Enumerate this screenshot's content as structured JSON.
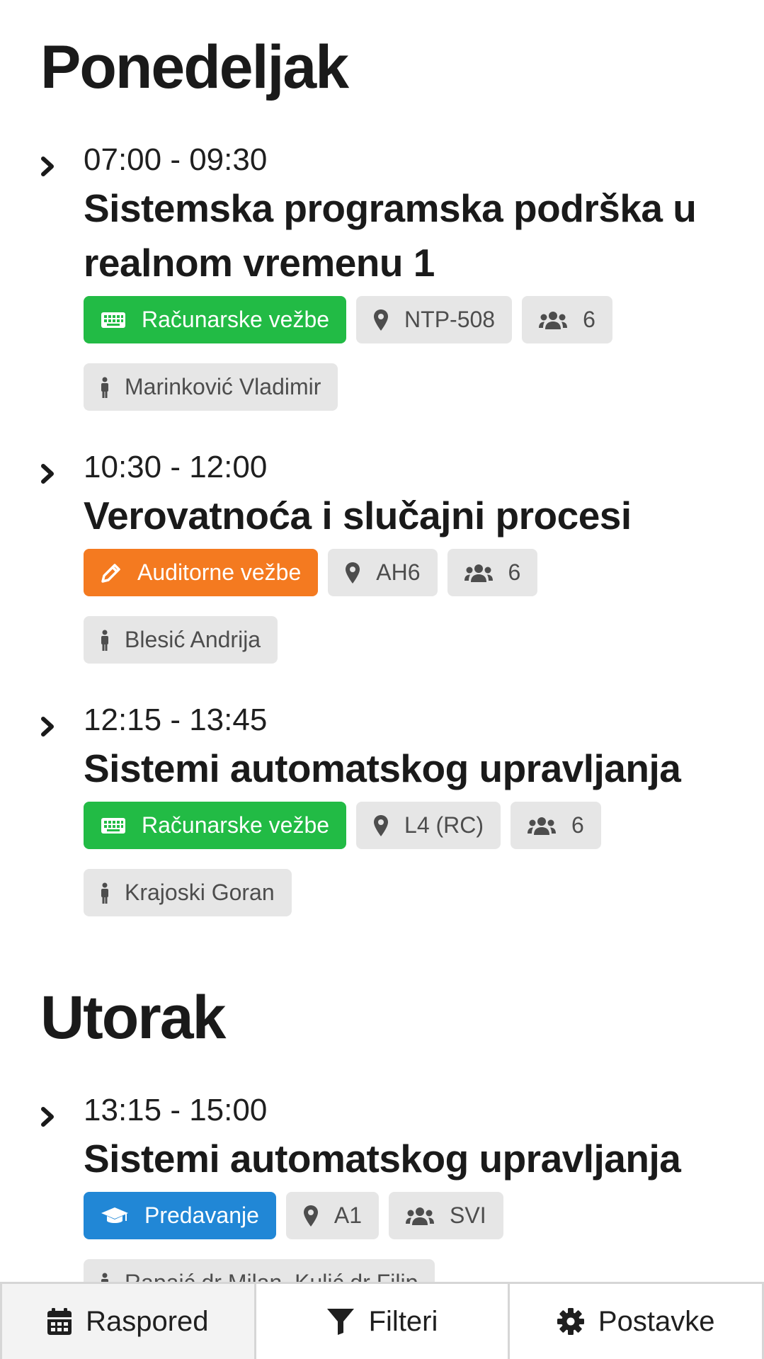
{
  "days": [
    {
      "title": "Ponedeljak",
      "lessons": [
        {
          "time": "07:00 - 09:30",
          "subject_line1": "Sistemska programska podrška u",
          "subject_line2": "realnom vremenu 1",
          "type": "Računarske vežbe",
          "type_icon": "keyboard-icon",
          "type_color": "#22bb45",
          "room": "NTP-508",
          "group": "6",
          "teacher": "Marinković Vladimir"
        },
        {
          "time": "10:30 - 12:00",
          "subject": "Verovatnoća i slučajni procesi",
          "type": "Auditorne vežbe",
          "type_icon": "pencil-icon",
          "type_color": "#f47a20",
          "room": "AH6",
          "group": "6",
          "teacher": "Blesić Andrija"
        },
        {
          "time": "12:15 - 13:45",
          "subject": "Sistemi automatskog upravljanja",
          "type": "Računarske vežbe",
          "type_icon": "keyboard-icon",
          "type_color": "#22bb45",
          "room": "L4 (RC)",
          "group": "6",
          "teacher": "Krajoski Goran"
        }
      ]
    },
    {
      "title": "Utorak",
      "lessons": [
        {
          "time": "13:15 - 15:00",
          "subject": "Sistemi automatskog upravljanja",
          "type": "Predavanje",
          "type_icon": "graduation-cap-icon",
          "type_color": "#2187d6",
          "room": "A1",
          "group": "SVI",
          "teacher": "Rapaić dr Milan, Kulić dr Filip"
        }
      ]
    }
  ],
  "bottom_nav": [
    {
      "label": "Raspored",
      "icon": "calendar-icon"
    },
    {
      "label": "Filteri",
      "icon": "filter-icon"
    },
    {
      "label": "Postavke",
      "icon": "gear-icon"
    }
  ]
}
